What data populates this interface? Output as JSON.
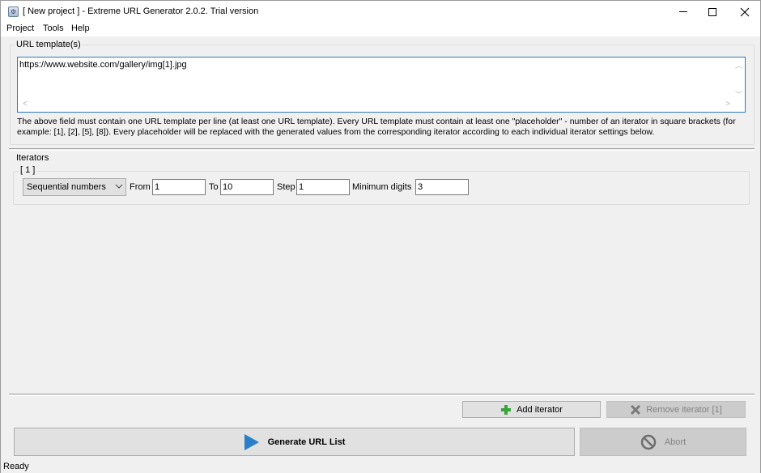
{
  "window": {
    "title": "[ New project ] - Extreme URL Generator 2.0.2. Trial version",
    "icon": "app-icon"
  },
  "menu": {
    "project": "Project",
    "tools": "Tools",
    "help": "Help"
  },
  "url_templates": {
    "label": "URL template(s)",
    "value": "https://www.website.com/gallery/img[1].jpg",
    "help": "The above field must contain one URL template per line (at least one URL template). Every URL template must contain at least one \"placeholder\" - number of an iterator in square brackets (for example: [1], [2], [5], [8]). Every placeholder will be replaced with the generated values from the corresponding iterator according to each individual iterator settings below."
  },
  "iterators": {
    "label": "Iterators",
    "items": [
      {
        "label": "[ 1 ]",
        "type": "Sequential numbers",
        "from_label": "From",
        "from": "1",
        "to_label": "To",
        "to": "10",
        "step_label": "Step",
        "step": "1",
        "min_digits_label": "Minimum digits",
        "min_digits": "3"
      }
    ]
  },
  "buttons": {
    "add_iterator": "Add iterator",
    "remove_iterator": "Remove iterator [1]",
    "generate": "Generate URL List",
    "abort": "Abort"
  },
  "status": "Ready",
  "colors": {
    "accent_blue": "#2b79c7",
    "play_blue": "#2a80c8",
    "plus_green": "#3aa43a"
  }
}
